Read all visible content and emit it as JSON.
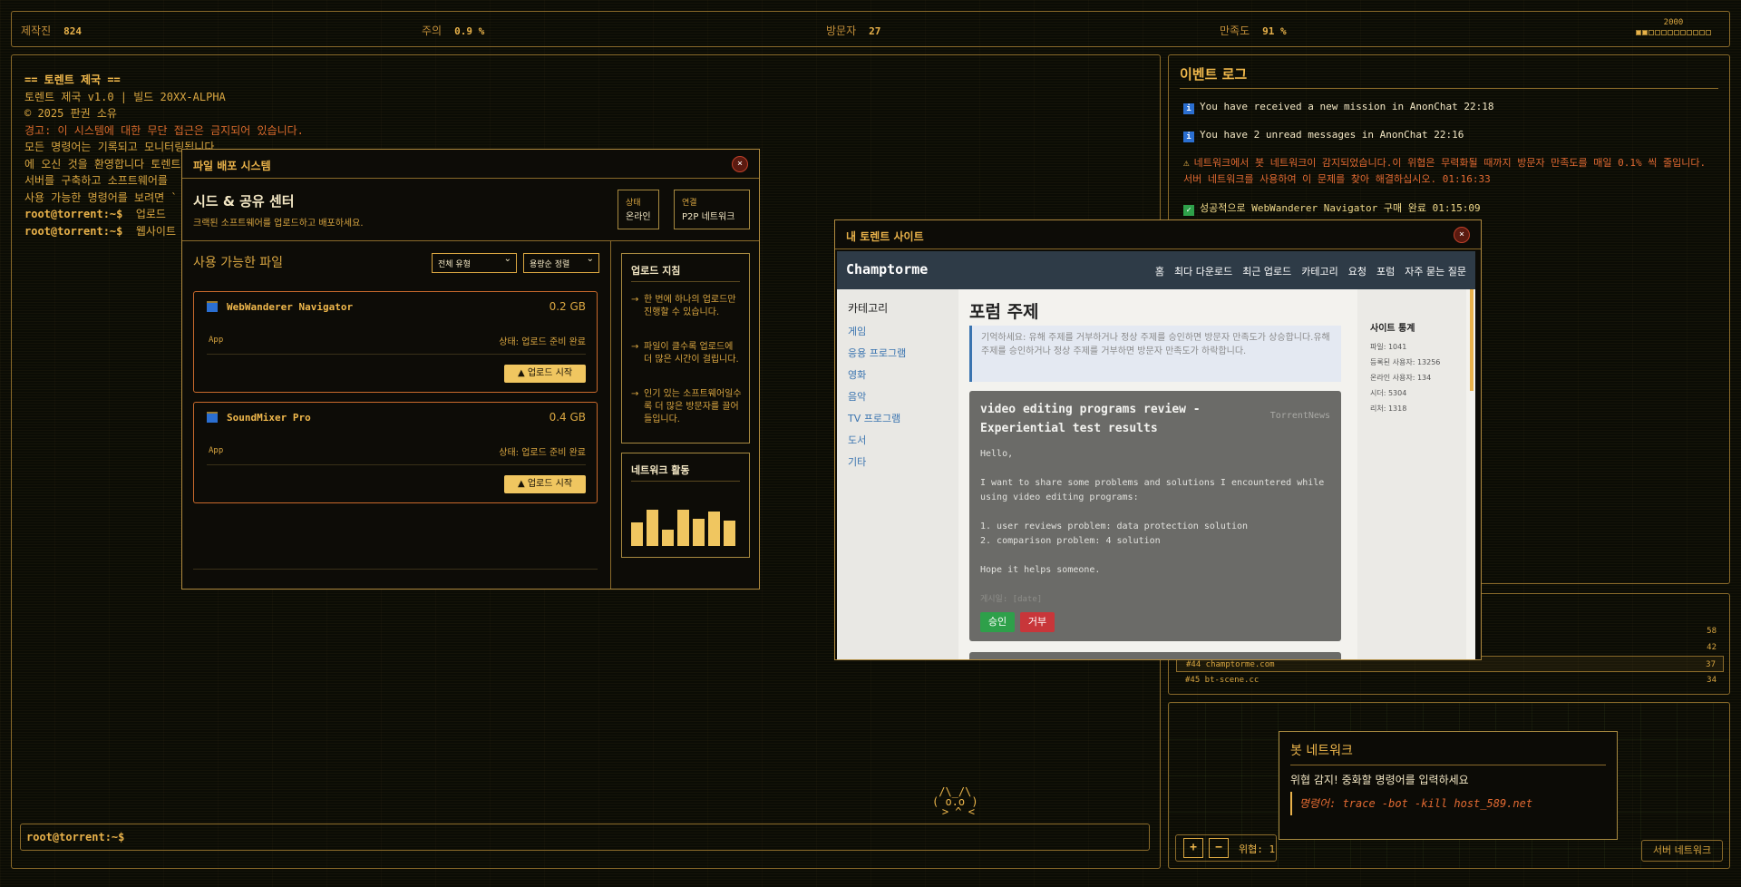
{
  "topbar": {
    "stats": [
      {
        "label": "제작진",
        "value": "824"
      },
      {
        "label": "주의",
        "value": "0.9 %"
      },
      {
        "label": "방문자",
        "value": "27"
      },
      {
        "label": "만족도",
        "value": "91 %"
      }
    ],
    "clock": "2000",
    "progress_fraction": 0.13
  },
  "terminal": {
    "lines": [
      {
        "text": "== 토렌트 제국 ==",
        "kind": "title"
      },
      {
        "text": "토렌트 제국 v1.0 | 빌드 20XX-ALPHA",
        "kind": "normal"
      },
      {
        "text": "© 2025 판권 소유",
        "kind": "normal"
      },
      {
        "text": "경고: 이 시스템에 대한 무단 접근은 금지되어 있습니다.",
        "kind": "warn"
      },
      {
        "text": "모든 명령어는 기록되고 모니터링됩니다",
        "kind": "normal"
      },
      {
        "text": "에 오신 것을 환영합니다 토렌트",
        "kind": "normal"
      },
      {
        "text": "서버를 구축하고 소프트웨어를",
        "kind": "normal"
      },
      {
        "text": "사용 가능한 명령어를 보려면 `",
        "kind": "normal"
      }
    ],
    "history": [
      {
        "prompt": "root@torrent:~$",
        "cmd": "업로드"
      },
      {
        "prompt": "root@torrent:~$",
        "cmd": "웹사이트"
      }
    ],
    "input_prompt": "root@torrent:~$"
  },
  "mascot": "/\\_/\\\n( o.o )\n > ^ <",
  "event_log": {
    "title": "이벤트 로그",
    "events": [
      {
        "type": "info",
        "icon": "info-icon",
        "text": "You have received a new mission in AnonChat 22:18"
      },
      {
        "type": "info",
        "icon": "info-icon",
        "text": "You have 2 unread messages in AnonChat 22:16"
      },
      {
        "type": "warn",
        "icon": "warning-icon",
        "text": "네트워크에서 봇 네트워크이 감지되었습니다.이 위협은 무력화될 때까지 방문자 만족도를 매일 0.1% 씩 줄입니다. 서버 네트워크를 사용하여 이 문제를 찾아 해결하십시오. 01:16:33"
      },
      {
        "type": "ok",
        "icon": "check-icon",
        "text": "성공적으로 WebWanderer Navigator 구매 완료 01:15:09"
      }
    ]
  },
  "site_list": {
    "rows": [
      {
        "name": "",
        "value": "58"
      },
      {
        "name": "",
        "value": "42"
      },
      {
        "name": "#44 champtorme.com",
        "value": "37"
      },
      {
        "name": "#45 bt-scene.cc",
        "value": "34"
      }
    ]
  },
  "bot_panel": {
    "plus": "+",
    "minus": "−",
    "threat_label": "위협: 1",
    "server_button": "서버 네트워크"
  },
  "botnet_popup": {
    "title": "봇 네트워크",
    "message": "위협 감지! 중화할 명령어를 입력하세요",
    "command": "명령어: trace -bot -kill host_589.net"
  },
  "file_dist": {
    "title": "파일 배포 시스템",
    "close": "×",
    "heading": "시드 & 공유 센터",
    "subheading": "크랙된 소프트웨어를 업로드하고 배포하세요.",
    "status_label": "상태",
    "status_value": "온라인",
    "conn_label": "연결",
    "conn_value": "P2P 네트워크",
    "available_label": "사용 가능한 파일",
    "filter_type": "전체 유형",
    "sort": "용량순 정렬",
    "files": [
      {
        "name": "WebWanderer Navigator",
        "size": "0.2 GB",
        "type": "App",
        "status": "상태: 업로드 준비 완료",
        "button": "▲ 업로드 시작"
      },
      {
        "name": "SoundMixer Pro",
        "size": "0.4 GB",
        "type": "App",
        "status": "상태: 업로드 준비 완료",
        "button": "▲ 업로드 시작"
      }
    ],
    "guide_title": "업로드 지침",
    "guides": [
      "한 번에 하나의 업로드만 진행할 수 있습니다.",
      "파일이 클수록 업로드에 더 많은 시간이 걸립니다.",
      "인기 있는 소프트웨어일수록 더 많은 방문자를 끌어들입니다."
    ],
    "activity_title": "네트워크 활동",
    "activity_levels": [
      0.65,
      1.0,
      0.45,
      1.0,
      0.75,
      0.95,
      0.7
    ]
  },
  "my_site": {
    "title": "내 토렌트 사이트",
    "close": "×",
    "brand": "Champtorme",
    "nav": [
      "홈",
      "최다 다운로드",
      "최근 업로드",
      "카테고리",
      "요청",
      "포럼",
      "자주 묻는 질문"
    ],
    "categories_title": "카테고리",
    "categories": [
      "게임",
      "응용 프로그램",
      "영화",
      "음악",
      "TV 프로그램",
      "도서",
      "기타"
    ],
    "page_title": "포럼 주제",
    "notice": "기억하세요: 유해 주제를 거부하거나 정상 주제를 승인하면 방문자 만족도가 상승합니다.유해 주제를 승인하거나 정상 주제를 거부하면 방문자 만족도가 하락합니다.",
    "post": {
      "title": "video editing programs review - Experiential test results",
      "author": "TorrentNews",
      "body": "Hello,\n\nI want to share some problems and solutions I encountered while using video editing programs:\n\n1. user reviews problem: data protection solution\n2. comparison problem: 4 solution\n\nHope it helps someone.",
      "footer": "게시일: [date]",
      "approve": "승인",
      "reject": "거부"
    },
    "stats_title": "사이트 통계",
    "stats": [
      "파일: 1041",
      "등록된 사용자: 13256",
      "온라인 사용자: 134",
      "시더: 5304",
      "리처: 1318"
    ]
  }
}
